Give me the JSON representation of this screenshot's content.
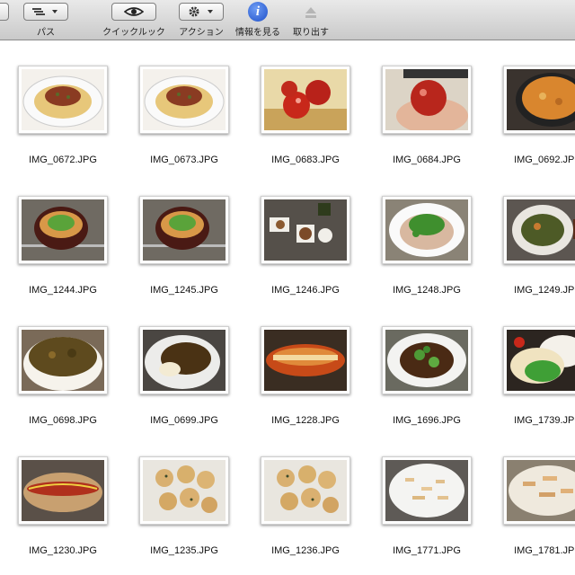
{
  "toolbar": {
    "path_label": "パス",
    "quicklook_label": "クイックルック",
    "action_label": "アクション",
    "info_label": "情報を見る",
    "eject_label": "取り出す"
  },
  "files": [
    {
      "name": "IMG_0672.JPG",
      "kind": "spaghetti"
    },
    {
      "name": "IMG_0673.JPG",
      "kind": "spaghetti"
    },
    {
      "name": "IMG_0683.JPG",
      "kind": "tomatoes"
    },
    {
      "name": "IMG_0684.JPG",
      "kind": "tomato-hand"
    },
    {
      "name": "IMG_0692.JPG",
      "kind": "pot"
    },
    {
      "name": "IMG_1244.JPG",
      "kind": "bowl-greens"
    },
    {
      "name": "IMG_1245.JPG",
      "kind": "bowl-greens"
    },
    {
      "name": "IMG_1246.JPG",
      "kind": "table-set"
    },
    {
      "name": "IMG_1248.JPG",
      "kind": "plate-greens"
    },
    {
      "name": "IMG_1249.JPG",
      "kind": "plate-veg"
    },
    {
      "name": "IMG_0698.JPG",
      "kind": "curry"
    },
    {
      "name": "IMG_0699.JPG",
      "kind": "curry-plate"
    },
    {
      "name": "IMG_1228.JPG",
      "kind": "bread"
    },
    {
      "name": "IMG_1696.JPG",
      "kind": "stirfry"
    },
    {
      "name": "IMG_1739.JPG",
      "kind": "rice-onion"
    },
    {
      "name": "IMG_1230.JPG",
      "kind": "hotdog"
    },
    {
      "name": "IMG_1235.JPG",
      "kind": "cookies"
    },
    {
      "name": "IMG_1236.JPG",
      "kind": "cookies"
    },
    {
      "name": "IMG_1771.JPG",
      "kind": "noodles"
    },
    {
      "name": "IMG_1781.JPG",
      "kind": "noodles2"
    }
  ]
}
